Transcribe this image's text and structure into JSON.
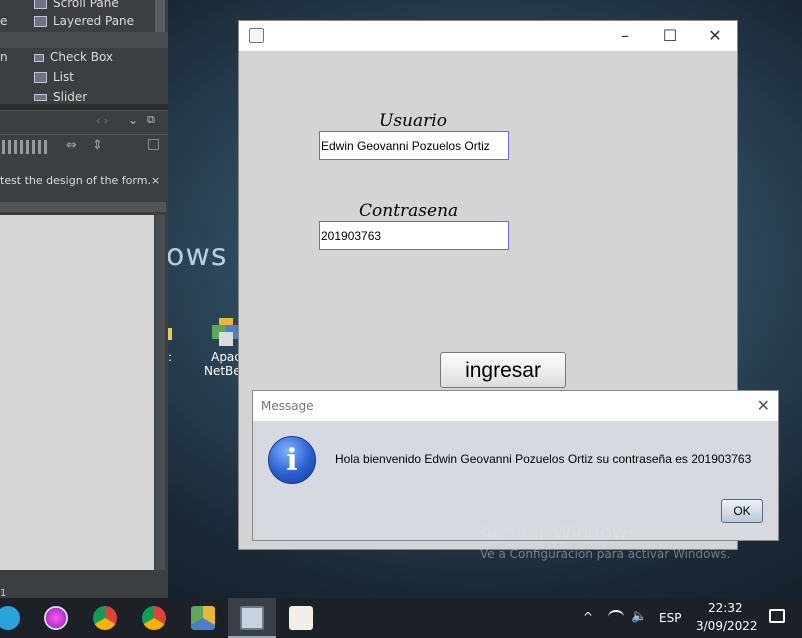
{
  "ide": {
    "palette": [
      {
        "label": "Scroll Pane",
        "icon": "scroll-pane-icon"
      },
      {
        "label": "Layered Pane",
        "icon": "layered-pane-icon"
      },
      {
        "label": "Check Box",
        "icon": "checkbox-icon"
      },
      {
        "label": "List",
        "icon": "list-icon"
      },
      {
        "label": "Slider",
        "icon": "slider-icon"
      }
    ],
    "left_fragments": [
      "e",
      "n"
    ],
    "hint_text": "test the design of the form.",
    "hint_close": "×",
    "bottom_fragment": "1"
  },
  "desktop": {
    "windows_text": "ows 1",
    "icon_label_line1": "Apac",
    "icon_label_line2": "NetBea",
    "colon": ":"
  },
  "main_window": {
    "usuario_label": "Usuario",
    "usuario_value": "Edwin Geovanni Pozuelos Ortiz",
    "contrasena_label": "Contrasena",
    "contrasena_value": "201903763",
    "ingresar_label": "ingresar",
    "minimize": "–",
    "maximize": "☐",
    "close": "✕"
  },
  "dialog": {
    "title": "Message",
    "close": "✕",
    "icon_glyph": "i",
    "message": "Hola bienvenido Edwin Geovanni Pozuelos Ortiz su contraseña es  201903763",
    "ok_label": "OK"
  },
  "activation": {
    "line1": "Activar Windows",
    "line2": "Ve a Configuración para activar Windows."
  },
  "taskbar": {
    "apps": [
      "telegram",
      "paint-app",
      "chrome-1",
      "chrome-2",
      "netbeans",
      "remote-desktop",
      "java"
    ],
    "language": "ESP",
    "time": "22:32",
    "date": "3/09/2022",
    "up_arrow": "^"
  }
}
